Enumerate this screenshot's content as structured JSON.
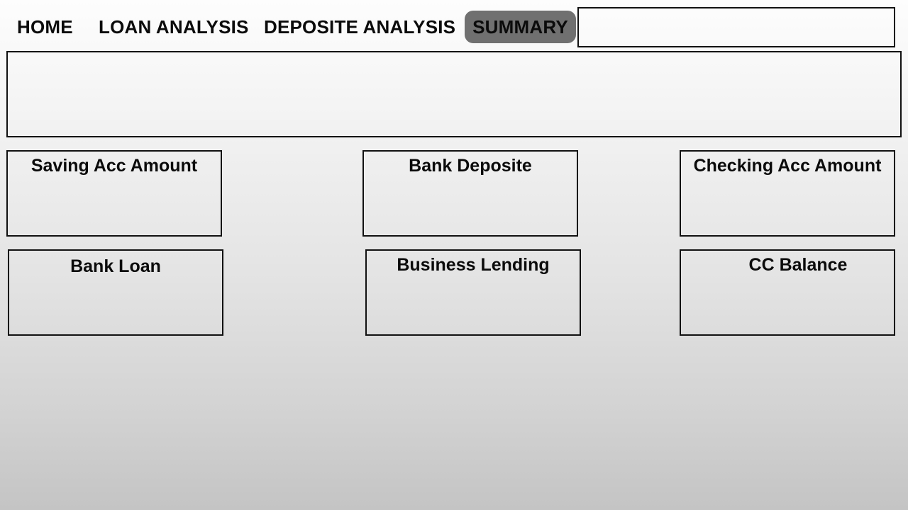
{
  "nav": {
    "home": "HOME",
    "loan_analysis": "LOAN ANALYSIS",
    "deposit_analysis": "DEPOSITE ANALYSIS",
    "summary": "SUMMARY",
    "active": "SUMMARY"
  },
  "cards": {
    "saving_acc_amount": "Saving Acc Amount",
    "bank_deposite": "Bank Deposite",
    "checking_acc_amount": "Checking Acc Amount",
    "bank_loan": "Bank Loan",
    "business_lending": "Business Lending",
    "cc_balance": "CC Balance"
  },
  "colors": {
    "active_tab_bg": "#707070",
    "border": "#111111",
    "text": "#0b0b0b"
  }
}
